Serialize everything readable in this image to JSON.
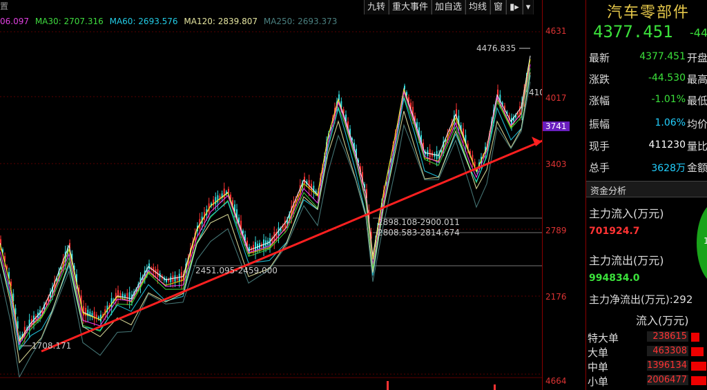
{
  "toolbar": {
    "corner_label": "置",
    "buttons": [
      "九转",
      "重大事件",
      "加自选",
      "均线",
      "窗"
    ]
  },
  "ma_bar": {
    "partial": "06.097",
    "ma30": "MA30: 2707.316",
    "ma60": "MA60: 2693.576",
    "ma120": "MA120: 2839.807",
    "ma250": "MA250: 2693.373",
    "colors": {
      "partial": "#e040e0",
      "ma30": "#3fdc3f",
      "ma60": "#22cce6",
      "ma120": "#e6e6a0",
      "ma250": "#4a8080"
    }
  },
  "price_axis": {
    "ticks": [
      "4631",
      "4017",
      "3741",
      "3403",
      "2789",
      "2176",
      "4664"
    ],
    "highlight_tick": "3741"
  },
  "annotations": {
    "high": "4476.835",
    "right_edge": "410",
    "level1": "2898.108-2900.011",
    "level2": "2808.583-2814.674",
    "level3": "2451.095-2459.000",
    "low": "1708.171"
  },
  "chart_data": {
    "type": "candlestick",
    "price_high_label": "4476.835",
    "price_low_label": "1708.171",
    "trendline_color": "#ff2020",
    "series_colors": {
      "candle_up": "#ff3333",
      "candle_down": "#33dddd",
      "ma5": "#ffffff",
      "ma10": "#e6e600",
      "ma20": "#ff40ff",
      "ma30": "#3fdc3f",
      "ma60": "#22cce6",
      "ma120": "#e6e6a0",
      "ma250": "#4a8080"
    }
  },
  "right_panel": {
    "title": "汽车零部件",
    "price": "4377.451",
    "change_partial": "-44",
    "rows": [
      {
        "label": "最新",
        "value": "4377.451",
        "label2": "开盘",
        "color": "#3be13b"
      },
      {
        "label": "涨跌",
        "value": "-44.530",
        "label2": "最高",
        "color": "#3be13b"
      },
      {
        "label": "涨幅",
        "value": "-1.01%",
        "label2": "最低",
        "color": "#3be13b"
      },
      {
        "label": "振幅",
        "value": "1.06%",
        "label2": "均价",
        "color": "#22d0ff"
      },
      {
        "label": "现手",
        "value": "411230",
        "label2": "量比",
        "color": "#ffffff"
      },
      {
        "label": "总手",
        "value": "3628万",
        "label2": "金额",
        "color": "#22d0ff"
      }
    ],
    "section": "资金分析",
    "inflow_label": "主力流入(万元)",
    "inflow_value": "701924.7",
    "outflow_label": "主力流出(万元)",
    "outflow_value": "994834.0",
    "net_label": "主力净流出(万元):292",
    "flow_header": "流入(万元)",
    "flow_rows": [
      {
        "name": "特大单",
        "value": "238615"
      },
      {
        "name": "大单",
        "value": "463308"
      },
      {
        "name": "中单",
        "value": "1396134"
      },
      {
        "name": "小单",
        "value": "2006477"
      }
    ],
    "pie_label": "1"
  }
}
